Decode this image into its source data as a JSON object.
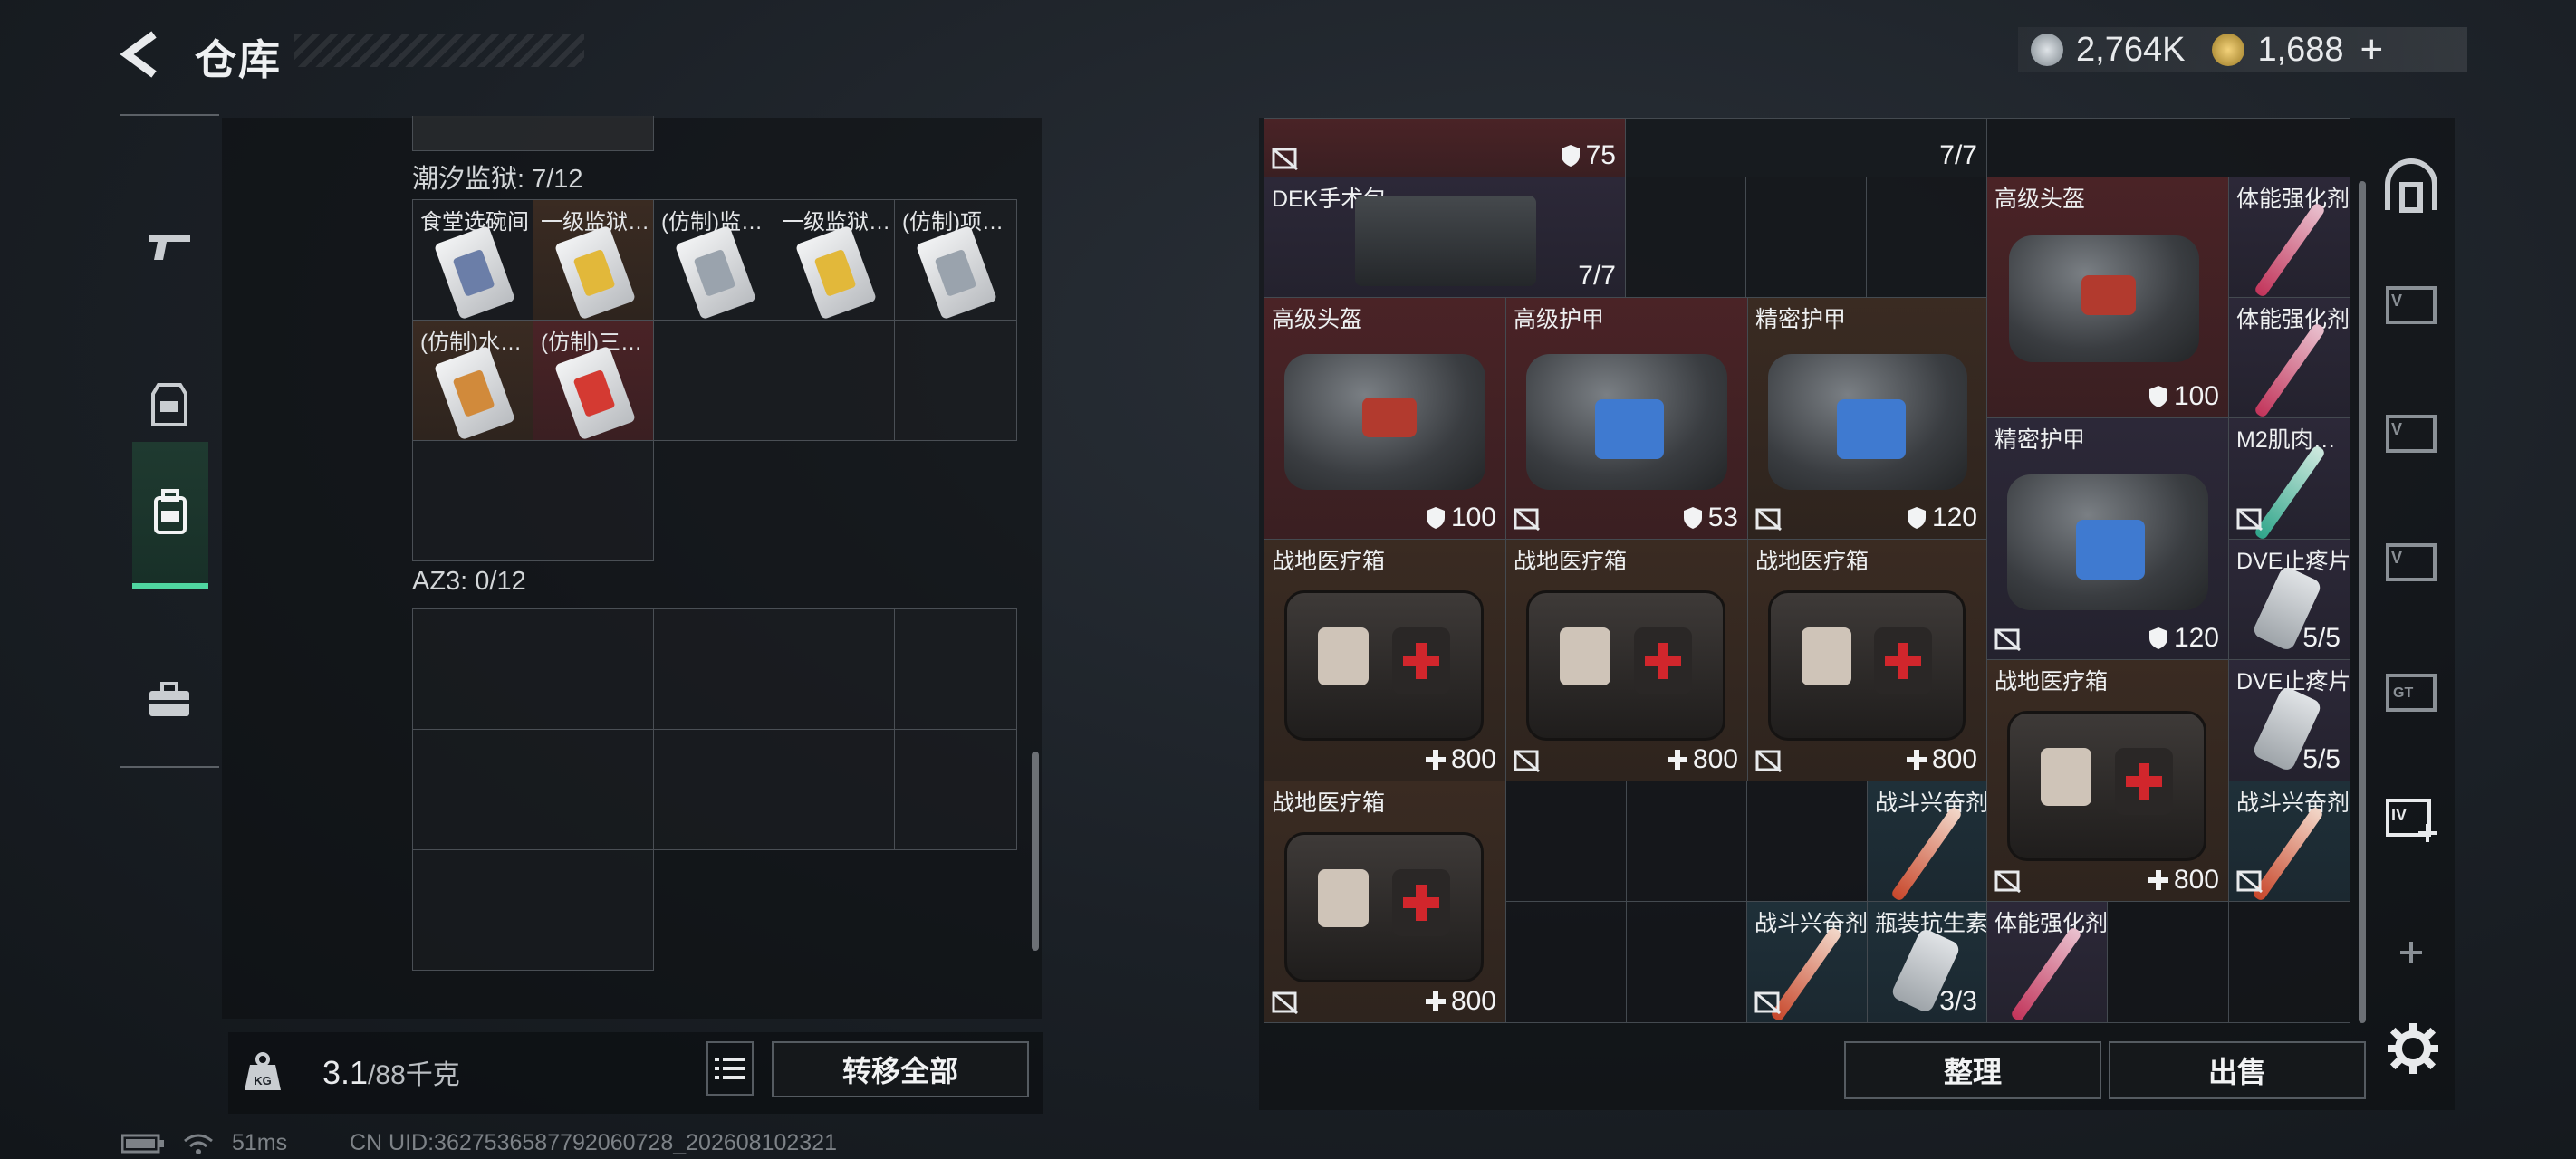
{
  "header": {
    "title": "仓库",
    "currency": [
      {
        "icon": "silver-coin-icon",
        "value": "2,764K",
        "color": "#b9c1c8"
      },
      {
        "icon": "gold-coin-icon",
        "value": "1,688",
        "color": "#d9b34a"
      }
    ],
    "add_label": "+"
  },
  "categories": [
    {
      "icon": "pistol-icon",
      "active": false
    },
    {
      "icon": "vest-icon",
      "active": false
    },
    {
      "icon": "backpack-icon",
      "active": true
    },
    {
      "icon": "briefcase-icon",
      "active": false
    }
  ],
  "left": {
    "sections": [
      {
        "title": "潮汐监狱: 7/12",
        "items": [
          {
            "label": "食堂选碗间",
            "accent": "#6b7ea8",
            "bg": "dark"
          },
          {
            "label": "一级监狱…",
            "accent": "#e2b83a",
            "bg": "brown"
          },
          {
            "label": "(仿制)监…",
            "accent": "#9aa3ad",
            "bg": "dark"
          },
          {
            "label": "一级监狱…",
            "accent": "#e2b83a",
            "bg": "dark"
          },
          {
            "label": "(仿制)项…",
            "accent": "#9aa3ad",
            "bg": "dark"
          },
          {
            "label": "(仿制)水…",
            "accent": "#d18a3b",
            "bg": "brown"
          },
          {
            "label": "(仿制)三…",
            "accent": "#d43a32",
            "bg": "red"
          }
        ]
      },
      {
        "title": "AZ3: 0/12",
        "items": []
      }
    ],
    "weight_value": "3.1",
    "weight_cap": "/88千克",
    "transfer_all": "转移全部"
  },
  "right": {
    "partial_top": [
      {
        "value": "75",
        "kind": "shield"
      },
      {
        "value": "7/7",
        "kind": "count"
      }
    ],
    "items": [
      {
        "id": "dek",
        "label": "DEK手术包",
        "value": "7/7"
      },
      {
        "id": "helmet1",
        "label": "高级头盔",
        "value": "100"
      },
      {
        "id": "stim1",
        "label": "体能强化剂",
        "value": ""
      },
      {
        "id": "stim2",
        "label": "体能强化剂",
        "value": ""
      },
      {
        "id": "helmet2",
        "label": "高级头盔",
        "value": "100"
      },
      {
        "id": "armor1",
        "label": "高级护甲",
        "value": "53"
      },
      {
        "id": "armor2",
        "label": "精密护甲",
        "value": "120"
      },
      {
        "id": "armor3",
        "label": "精密护甲",
        "value": "120"
      },
      {
        "id": "m2",
        "label": "M2肌肉…",
        "value": ""
      },
      {
        "id": "med1",
        "label": "战地医疗箱",
        "value": "800"
      },
      {
        "id": "med2",
        "label": "战地医疗箱",
        "value": "800"
      },
      {
        "id": "med3",
        "label": "战地医疗箱",
        "value": "800"
      },
      {
        "id": "dve1",
        "label": "DVE止疼片",
        "value": "5/5"
      },
      {
        "id": "dve2",
        "label": "DVE止疼片",
        "value": "5/5"
      },
      {
        "id": "med4",
        "label": "战地医疗箱",
        "value": "800"
      },
      {
        "id": "med5",
        "label": "战地医疗箱",
        "value": "800"
      },
      {
        "id": "combat1",
        "label": "战斗兴奋剂",
        "value": ""
      },
      {
        "id": "combat2",
        "label": "战斗兴奋剂",
        "value": ""
      },
      {
        "id": "combat3",
        "label": "战斗兴奋剂",
        "value": ""
      },
      {
        "id": "antib",
        "label": "瓶装抗生素",
        "value": "3/3"
      },
      {
        "id": "stim3",
        "label": "体能强化剂",
        "value": ""
      }
    ],
    "sort_label": "整理",
    "sell_label": "出售"
  },
  "right_rail": [
    "hideout-icon",
    "vcard-icon",
    "vcard-icon",
    "vcard-icon",
    "gtickets-icon",
    "iv-plus-icon",
    "plus-icon"
  ],
  "status": {
    "ping": "51ms",
    "uid": "CN UID:3627536587792060728_202608102321"
  }
}
